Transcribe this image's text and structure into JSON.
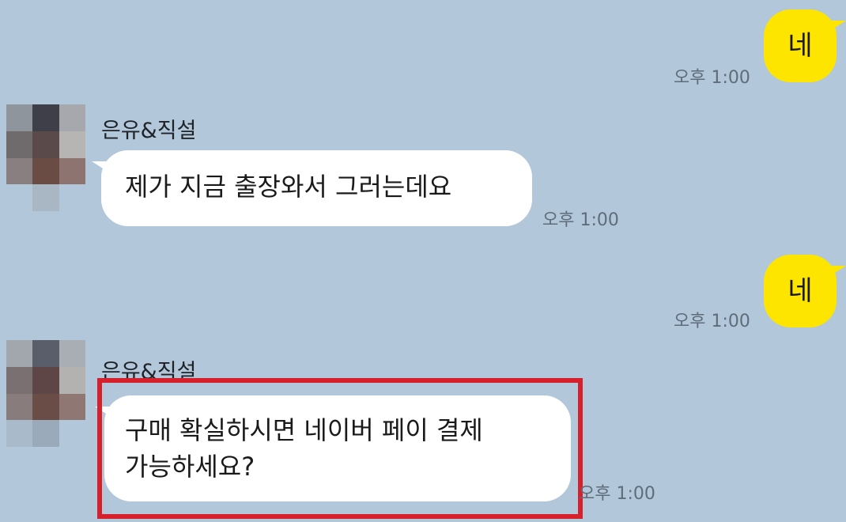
{
  "chat": {
    "messages": [
      {
        "direction": "outgoing",
        "text": "네",
        "time": "오후 1:00"
      },
      {
        "direction": "incoming",
        "sender": "은유&직설",
        "text": "제가 지금 출장와서 그러는데요",
        "time": "오후 1:00"
      },
      {
        "direction": "outgoing",
        "text": "네",
        "time": "오후 1:00"
      },
      {
        "direction": "incoming",
        "sender": "은유&직설",
        "lines": [
          "구매 확실하시면 네이버 페이 결제",
          "가능하세요?"
        ],
        "time": "오후 1:00",
        "highlighted": true
      }
    ]
  },
  "colors": {
    "background": "#b2c7da",
    "outgoing_bubble": "#fee500",
    "incoming_bubble": "#ffffff",
    "highlight_border": "#d6202b"
  }
}
